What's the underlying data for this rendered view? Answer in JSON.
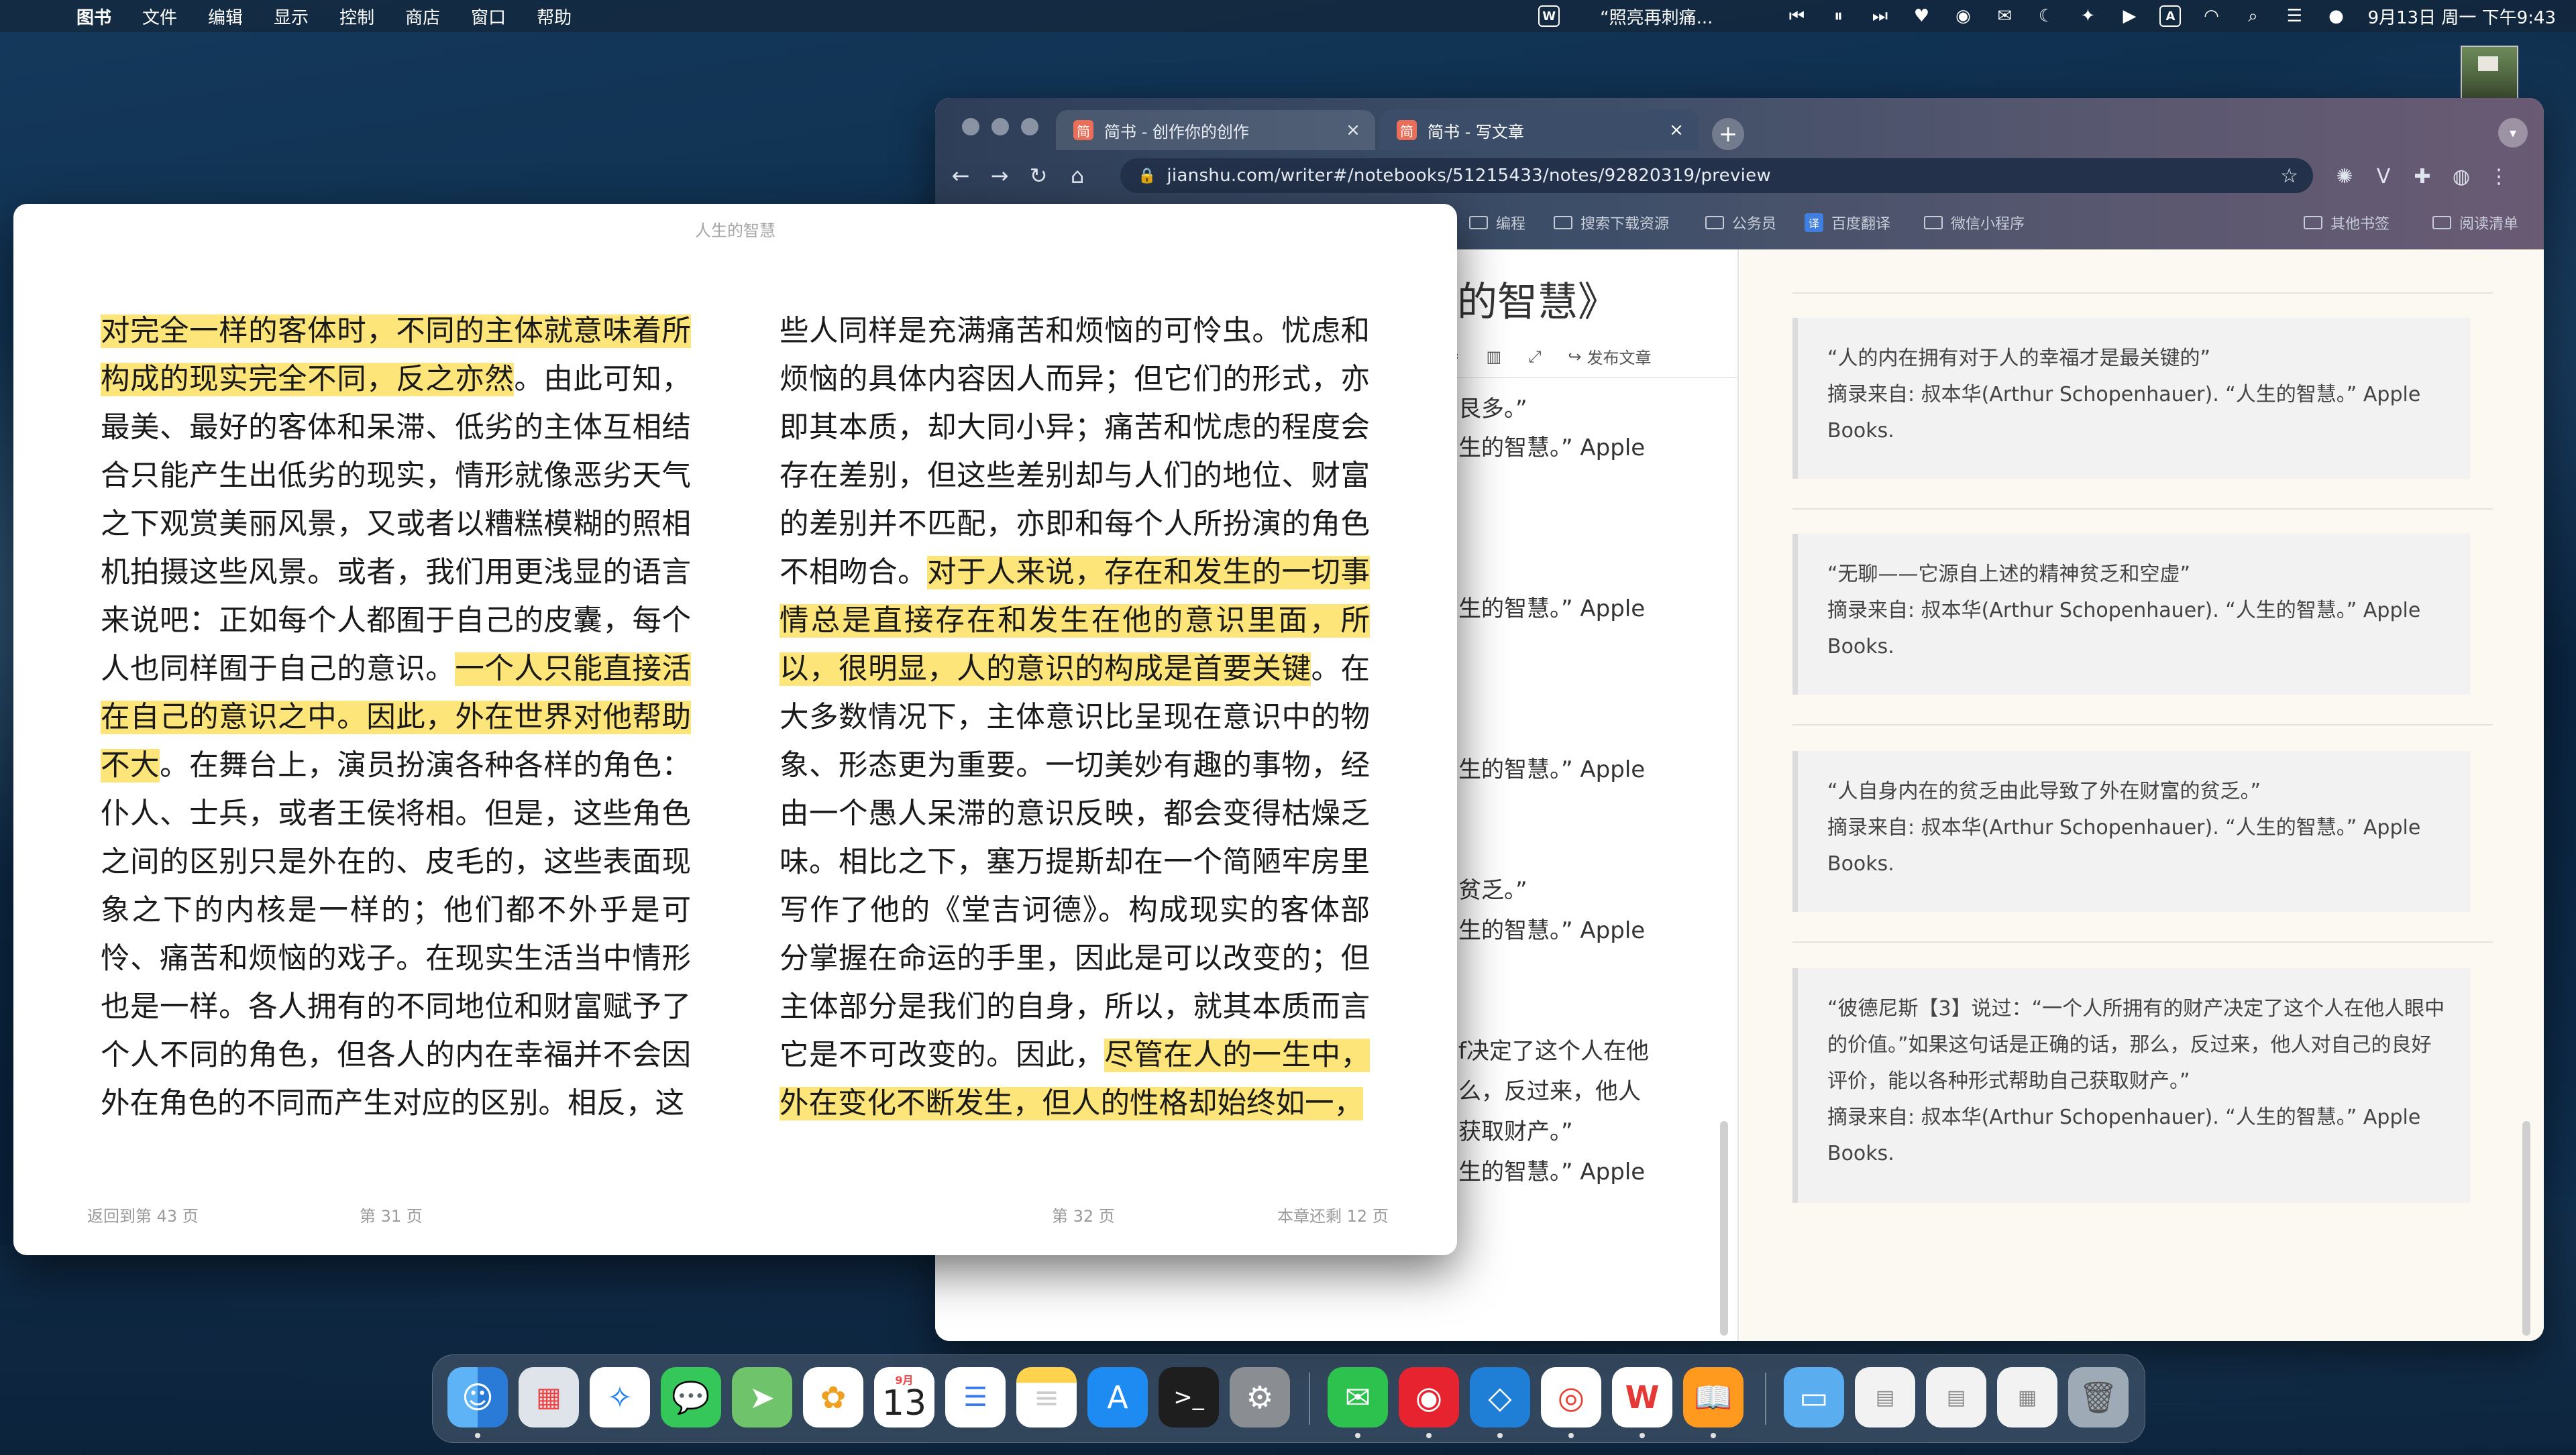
{
  "menubar": {
    "app_name": "图书",
    "items": [
      "文件",
      "编辑",
      "显示",
      "控制",
      "商店",
      "窗口",
      "帮助"
    ],
    "now_playing": "“照亮再刺痛...",
    "clock": "9月13日 周一 下午9:43",
    "input_method": "A"
  },
  "chrome": {
    "tabs": [
      {
        "favicon": "简",
        "title": "简书 - 创作你的创作",
        "close": "×"
      },
      {
        "favicon": "简",
        "title": "简书 - 写文章",
        "close": "×"
      }
    ],
    "new_tab": "+",
    "url": "jianshu.com/writer#/notebooks/51215433/notes/92820319/preview",
    "bookmarks": [
      "编程",
      "搜索下载资源",
      "公务员",
      "百度翻译",
      "微信小程序",
      "其他书签",
      "阅读清单"
    ],
    "bookmark_translate_icon": "译"
  },
  "editor": {
    "title": "的智慧》",
    "publish_label": "发布文章",
    "lines": [
      "艮多。”",
      "生的智慧。” Apple",
      "生的智慧。” Apple",
      "生的智慧。” Apple",
      "贫乏。”",
      "生的智慧。” Apple",
      "f决定了这个人在他",
      "么，反过来，他人",
      "获取财产。”",
      "生的智慧。” Apple"
    ]
  },
  "preview": {
    "quotes": [
      {
        "text": "“人的内在拥有对于人的幸福才是最关键的”",
        "source": "摘录来自: 叔本华(Arthur Schopenhauer). “人生的智慧。” Apple Books."
      },
      {
        "text": "“无聊——它源自上述的精神贫乏和空虚”",
        "source": "摘录来自: 叔本华(Arthur Schopenhauer). “人生的智慧。” Apple Books."
      },
      {
        "text": "“人自身内在的贫乏由此导致了外在财富的贫乏。”",
        "source": "摘录来自: 叔本华(Arthur Schopenhauer). “人生的智慧。” Apple Books."
      },
      {
        "text": "“彼德尼斯【3】说过：“一个人所拥有的财产决定了这个人在他人眼中的价值。”如果这句话是正确的话，那么，反过来，他人对自己的良好评价，能以各种形式帮助自己获取财产。”",
        "source": "摘录来自: 叔本华(Arthur Schopenhauer). “人生的智慧。” Apple Books."
      }
    ]
  },
  "reader": {
    "book_title": "人生的智慧",
    "left_page": {
      "hl1": "对完全一样的客体时，不同的主体就意味着所构成的现实完全不同，反之亦然",
      "t1": "。由此可知，最美、最好的客体和呆滞、低劣的主体互相结合只能产生出低劣的现实，情形就像恶劣天气之下观赏美丽风景，又或者以糟糕模糊的照相机拍摄这些风景。或者，我们用更浅显的语言来说吧：正如每个人都囿于自己的皮囊，每个人也同样囿于自己的意识。",
      "hl2": "一个人只能直接活在自己的意识之中。因此，外在世界对他帮助不大",
      "t2": "。在舞台上，演员扮演各种各样的角色：仆人、士兵，或者王侯将相。但是，这些角色之间的区别只是外在的、皮毛的，这些表面现象之下的内核是一样的；他们都不外乎是可怜、痛苦和烦恼的戏子。在现实生活当中情形也是一样。各人拥有的不同地位和财富赋予了个人不同的角色，但各人的内在幸福并不会因外在角色的不同而产生对应的区别。相反，这"
    },
    "right_page": {
      "t1": "些人同样是充满痛苦和烦恼的可怜虫。忧虑和烦恼的具体内容因人而异；但它们的形式，亦即其本质，却大同小异；痛苦和忧虑的程度会存在差别，但这些差别却与人们的地位、财富的差别并不匹配，亦即和每个人所扮演的角色不相吻合。",
      "hl1": "对于人来说，存在和发生的一切事情总是直接存在和发生在他的意识里面，所以，很明显，人的意识的构成是首要关键",
      "t2": "。在大多数情况下，主体意识比呈现在意识中的物象、形态更为重要。一切美妙有趣的事物，经由一个愚人呆滞的意识反映，都会变得枯燥乏味。相比之下，塞万提斯却在一个简陋牢房里写作了他的《堂吉诃德》。构成现实的客体部分掌握在命运的手里，因此是可以改变的；但主体部分是我们的自身，所以，就其本质而言它是不可改变的。因此，",
      "hl2": "尽管在人的一生中，外在变化不断发生，但人的性格却始终如一，"
    },
    "footer": {
      "back": "返回到第 43 页",
      "left_page_no": "第 31 页",
      "right_page_no": "第 32 页",
      "remaining": "本章还剩 12 页"
    }
  },
  "dock": {
    "calendar_month": "9月",
    "calendar_day": "13"
  }
}
